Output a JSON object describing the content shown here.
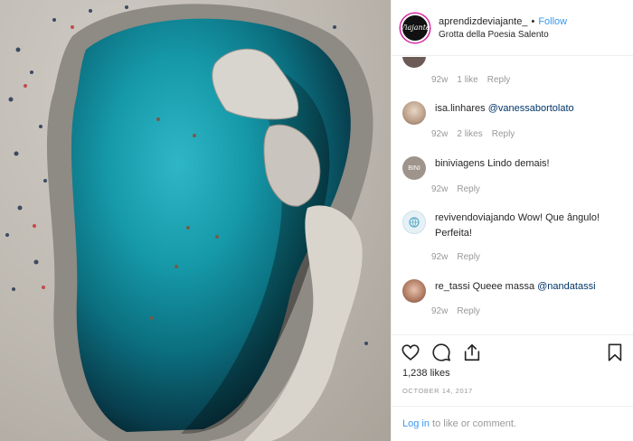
{
  "header": {
    "avatar_text": "Viajante",
    "username": "aprendizdeviajante_",
    "separator": "•",
    "follow_label": "Follow",
    "location": "Grotta della Poesia Salento"
  },
  "comments": [
    {
      "user": "",
      "avatar_text": "",
      "text": "😂😂",
      "mention": "",
      "time": "92w",
      "likes": "1 like",
      "reply": "Reply",
      "avatar_color": "#6b5a55"
    },
    {
      "user": "isa.linhares",
      "avatar_text": "",
      "text": "",
      "mention": "@vanessabortolato",
      "time": "92w",
      "likes": "2 likes",
      "reply": "Reply",
      "avatar_color": "#c9b8a8"
    },
    {
      "user": "biniviagens",
      "avatar_text": "BINI",
      "text": "Lindo demais!",
      "mention": "",
      "time": "92w",
      "likes": "",
      "reply": "Reply",
      "avatar_color": "#9e948c"
    },
    {
      "user": "revivendoviajando",
      "avatar_text": "",
      "text": "Wow! Que ângulo! Perfeita!",
      "mention": "",
      "time": "92w",
      "likes": "",
      "reply": "Reply",
      "avatar_color": "#e6f1f6"
    },
    {
      "user": "re_tassi",
      "avatar_text": "",
      "text": "Queee massa",
      "mention": "@nandatassi",
      "time": "92w",
      "likes": "",
      "reply": "Reply",
      "avatar_color": "#a87f6d"
    }
  ],
  "actions": {
    "like_icon": "heart-icon",
    "comment_icon": "comment-icon",
    "share_icon": "share-icon",
    "save_icon": "bookmark-icon"
  },
  "likes_count": "1,238 likes",
  "date": "OCTOBER 14, 2017",
  "add_comment": {
    "login_label": "Log in",
    "rest": " to like or comment."
  },
  "colors": {
    "link": "#3897f0",
    "mention": "#003569",
    "muted": "#999999"
  }
}
